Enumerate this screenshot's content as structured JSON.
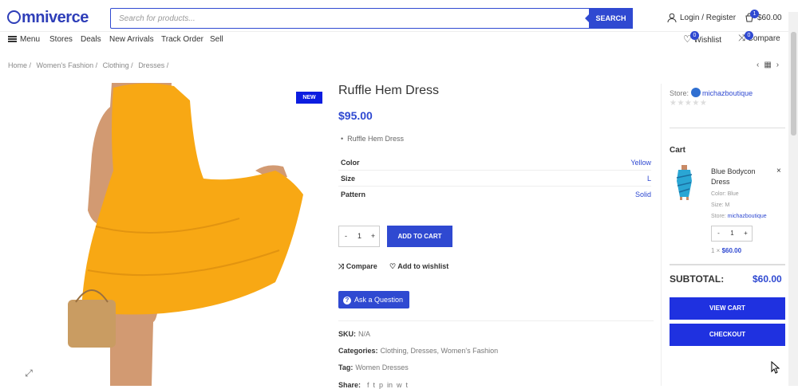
{
  "header": {
    "logo": "mniverce",
    "search_placeholder": "Search for products...",
    "search_button": "SEARCH",
    "login": "Login / Register",
    "cart_count": "1",
    "cart_total": "$60.00"
  },
  "nav": {
    "menu": "Menu",
    "items": [
      "Stores",
      "Deals",
      "New Arrivals",
      "Track Order",
      "Sell"
    ],
    "wishlist": "Wishlist",
    "wishlist_count": "0",
    "compare": "Compare",
    "compare_count": "0"
  },
  "breadcrumb": [
    "Home /",
    "Women's Fashion /",
    "Clothing /",
    "Dresses /"
  ],
  "product": {
    "badge": "NEW",
    "title": "Ruffle Hem Dress",
    "price": "$95.00",
    "short_desc": "Ruffle Hem Dress",
    "attributes": [
      {
        "name": "Color",
        "value": "Yellow"
      },
      {
        "name": "Size",
        "value": "L"
      },
      {
        "name": "Pattern",
        "value": "Solid"
      }
    ],
    "qty": "1",
    "add_to_cart": "ADD TO CART",
    "compare": "Compare",
    "wishlist": "Add to wishlist",
    "ask": "Ask a Question",
    "sku_label": "SKU:",
    "sku": "N/A",
    "categories_label": "Categories:",
    "categories": "Clothing, Dresses, Women's Fashion",
    "tag_label": "Tag:",
    "tag": "Women Dresses",
    "share_label": "Share:"
  },
  "sidebar": {
    "store_label": "Store:",
    "store_name": "michazboutique",
    "stars": "★★★★★",
    "cart_title": "Cart",
    "item": {
      "name": "Blue Bodycon Dress",
      "color": "Color: Blue",
      "size": "Size: M",
      "store_label": "Store:",
      "store": "michazboutique",
      "qty": "1",
      "line_prefix": "1 ×",
      "line_price": "$60.00"
    },
    "subtotal_label": "SUBTOTAL:",
    "subtotal": "$60.00",
    "view_cart": "VIEW CART",
    "checkout": "CHECKOUT"
  },
  "colors": {
    "accent": "#2f49d1",
    "dress": "#f8a814",
    "badge": "#0c1de0"
  }
}
